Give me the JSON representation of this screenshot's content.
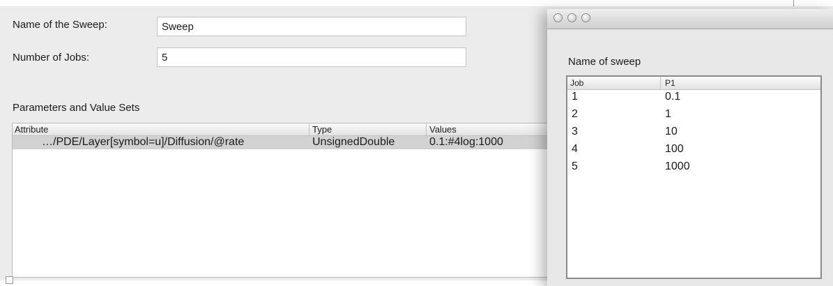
{
  "form": {
    "name_label": "Name of the Sweep:",
    "name_value": "Sweep",
    "jobs_label": "Number of Jobs:",
    "jobs_value": "5"
  },
  "parameters": {
    "section_title": "Parameters and Value Sets",
    "headers": [
      "Attribute",
      "Type",
      "Values"
    ],
    "rows": [
      [
        "…/PDE/Layer[symbol=u]/Diffusion/@rate",
        "UnsignedDouble",
        "0.1:#4log:1000"
      ]
    ]
  },
  "sweep_window": {
    "label": "Name of sweep",
    "headers": [
      "Job",
      "P1"
    ],
    "rows": [
      [
        "1",
        "0.1"
      ],
      [
        "2",
        "1"
      ],
      [
        "3",
        "10"
      ],
      [
        "4",
        "100"
      ],
      [
        "5",
        "1000"
      ]
    ]
  }
}
